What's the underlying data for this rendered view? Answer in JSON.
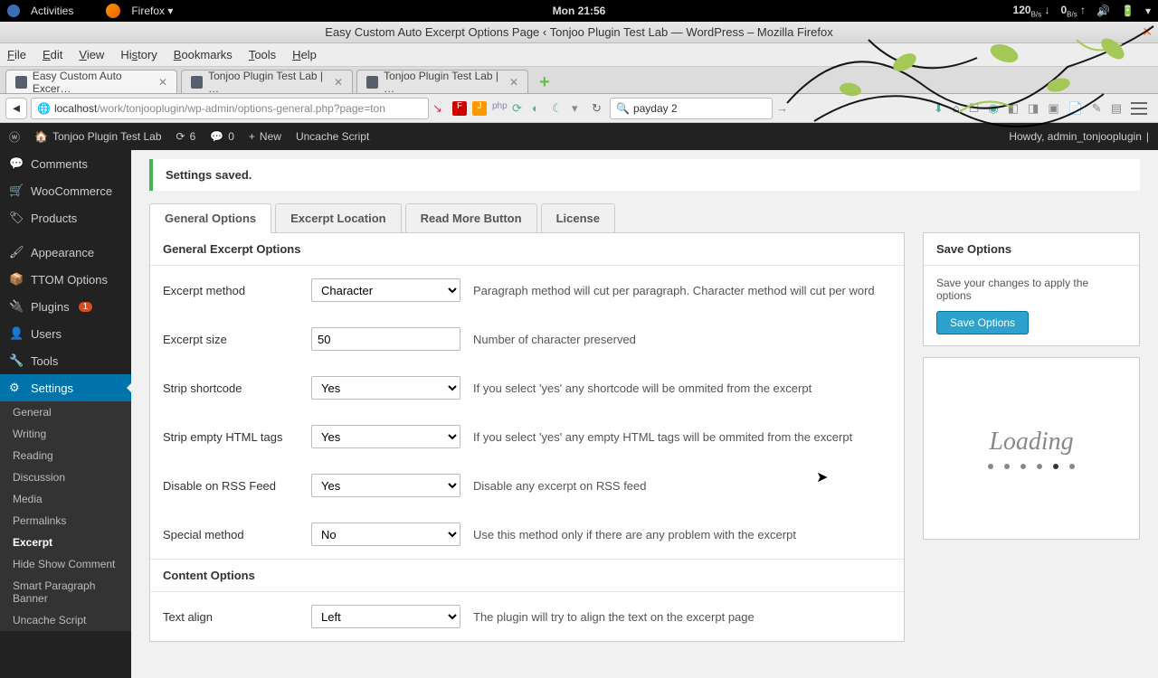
{
  "gnome": {
    "activities": "Activities",
    "firefox": "Firefox ▾",
    "clock": "Mon 21:56",
    "net1": "120",
    "net1u": "B/s",
    "net2": "0",
    "net2u": "B/s"
  },
  "window_title": "Easy Custom Auto Excerpt Options Page ‹ Tonjoo Plugin Test Lab — WordPress – Mozilla Firefox",
  "menubar": [
    "File",
    "Edit",
    "View",
    "History",
    "Bookmarks",
    "Tools",
    "Help"
  ],
  "tabs": [
    {
      "label": "Easy Custom Auto Excer…",
      "active": true
    },
    {
      "label": "Tonjoo Plugin Test Lab | …",
      "active": false
    },
    {
      "label": "Tonjoo Plugin Test Lab | …",
      "active": false
    }
  ],
  "url": {
    "host": "localhost",
    "path": "/work/tonjooplugin/wp-admin/options-general.php?page=ton"
  },
  "search_q": "payday 2",
  "wpbar": {
    "site": "Tonjoo Plugin Test Lab",
    "updates": "6",
    "comments": "0",
    "new": "New",
    "uncache": "Uncache Script",
    "howdy": "Howdy, admin_tonjooplugin"
  },
  "sidebar": {
    "items": [
      {
        "label": "Comments"
      },
      {
        "label": "WooCommerce"
      },
      {
        "label": "Products"
      },
      {
        "label": "Appearance"
      },
      {
        "label": "TTOM Options"
      },
      {
        "label": "Plugins",
        "badge": "1"
      },
      {
        "label": "Users"
      },
      {
        "label": "Tools"
      },
      {
        "label": "Settings",
        "active": true
      }
    ],
    "sub": [
      "General",
      "Writing",
      "Reading",
      "Discussion",
      "Media",
      "Permalinks",
      "Excerpt",
      "Hide Show Comment",
      "Smart Paragraph Banner",
      "Uncache Script"
    ],
    "sub_current": "Excerpt"
  },
  "notice": "Settings saved.",
  "opt_tabs": [
    "General Options",
    "Excerpt Location",
    "Read More Button",
    "License"
  ],
  "section1": "General Excerpt Options",
  "section2": "Content Options",
  "rows": [
    {
      "label": "Excerpt method",
      "value": "Character",
      "type": "select",
      "desc": "Paragraph method will cut per paragraph. Character method will cut per word"
    },
    {
      "label": "Excerpt size",
      "value": "50",
      "type": "number",
      "desc": "Number of character preserved"
    },
    {
      "label": "Strip shortcode",
      "value": "Yes",
      "type": "select",
      "desc": "If you select 'yes' any shortcode will be ommited from the excerpt"
    },
    {
      "label": "Strip empty HTML tags",
      "value": "Yes",
      "type": "select",
      "desc": "If you select 'yes' any empty HTML tags will be ommited from the excerpt"
    },
    {
      "label": "Disable on RSS Feed",
      "value": "Yes",
      "type": "select",
      "desc": "Disable any excerpt on RSS feed"
    },
    {
      "label": "Special method",
      "value": "No",
      "type": "select",
      "desc": "Use this method only if there are any problem with the excerpt"
    }
  ],
  "rows2": [
    {
      "label": "Text align",
      "value": "Left",
      "type": "select",
      "desc": "The plugin will try to align the text on the excerpt page"
    }
  ],
  "savebox": {
    "title": "Save Options",
    "text": "Save your changes to apply the options",
    "btn": "Save Options"
  },
  "loading": "Loading"
}
